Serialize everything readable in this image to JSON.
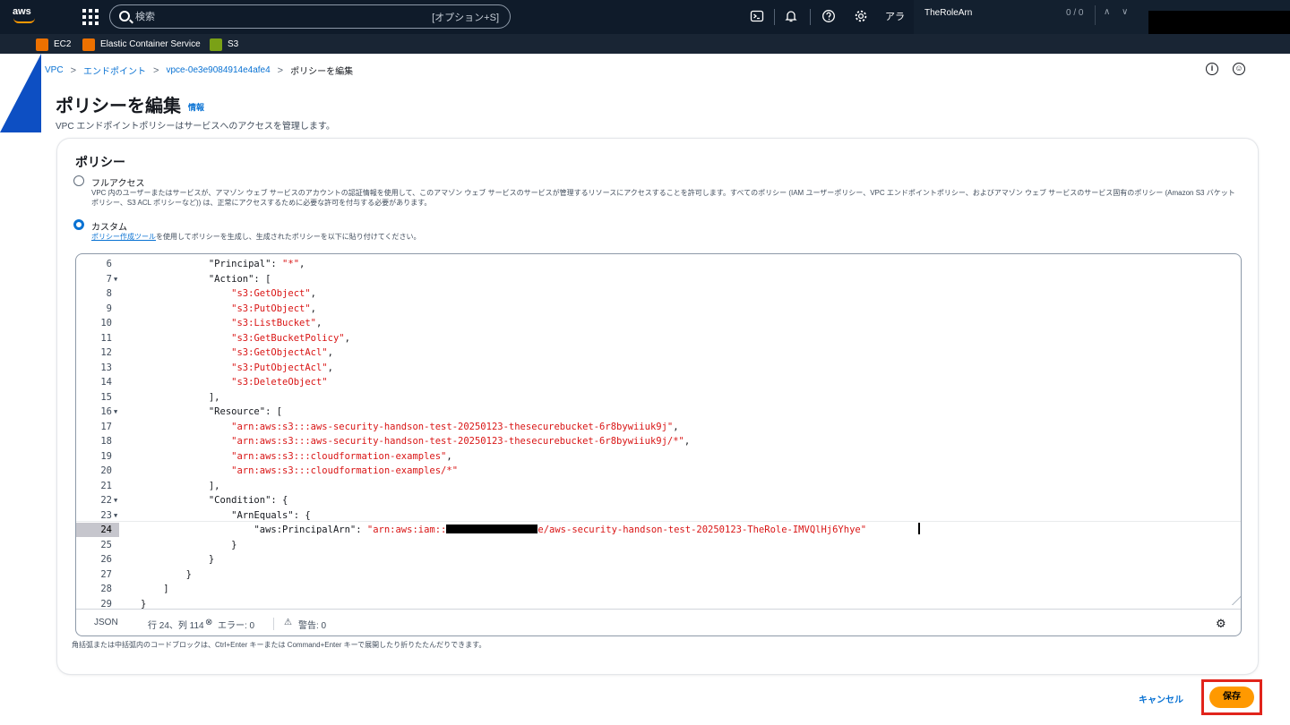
{
  "topnav": {
    "logo": "aws",
    "search_placeholder": "検索",
    "search_shortcut": "[オプション+S]",
    "account_truncated": "アラ",
    "icons": [
      "grid-icon",
      "cloudshell-icon",
      "bell-icon",
      "help-icon",
      "settings-icon"
    ],
    "find_bar": {
      "query": "TheRoleArn",
      "count": "0 / 0"
    }
  },
  "favorites": [
    {
      "label": "EC2",
      "icon": "ec2-icon",
      "color": "#ed7100"
    },
    {
      "label": "Elastic Container Service",
      "icon": "ecs-icon",
      "color": "#ed7100"
    },
    {
      "label": "S3",
      "icon": "s3-icon",
      "color": "#7aa116"
    }
  ],
  "breadcrumb": [
    {
      "label": "VPC",
      "link": true
    },
    {
      "label": "エンドポイント",
      "link": true
    },
    {
      "label": "vpce-0e3e9084914e4afe4",
      "link": true
    },
    {
      "label": "ポリシーを編集",
      "link": false
    }
  ],
  "header": {
    "title": "ポリシーを編集",
    "info": "情報",
    "description": "VPC エンドポイントポリシーはサービスへのアクセスを管理します。"
  },
  "policy": {
    "title": "ポリシー",
    "options": [
      {
        "label": "フルアクセス",
        "checked": false,
        "description": "VPC 内のユーザーまたはサービスが、アマゾン ウェブ サービスのアカウントの認証情報を使用して、このアマゾン ウェブ サービスのサービスが管理するリソースにアクセスすることを許可します。すべてのポリシー (IAM ユーザーポリシー、VPC エンドポイントポリシー、およびアマゾン ウェブ サービスのサービス固有のポリシー (Amazon S3 バケットポリシー、S3 ACL ポリシーなど)) は、正常にアクセスするために必要な許可を付与する必要があります。"
      },
      {
        "label": "カスタム",
        "checked": true,
        "description_link": "ポリシー作成ツール",
        "description": "を使用してポリシーを生成し、生成されたポリシーを以下に貼り付けてください。"
      }
    ]
  },
  "editor": {
    "lines": [
      {
        "n": "6",
        "fold": "",
        "indent": "            ",
        "parts": [
          {
            "t": "\"Principal\": ",
            "s": false
          },
          {
            "t": "\"*\"",
            "s": true
          },
          {
            "t": ",",
            "s": false
          }
        ]
      },
      {
        "n": "7",
        "fold": "▼",
        "indent": "            ",
        "parts": [
          {
            "t": "\"Action\": [",
            "s": false
          }
        ]
      },
      {
        "n": "8",
        "fold": "",
        "indent": "                ",
        "parts": [
          {
            "t": "\"s3:GetObject\"",
            "s": true
          },
          {
            "t": ",",
            "s": false
          }
        ]
      },
      {
        "n": "9",
        "fold": "",
        "indent": "                ",
        "parts": [
          {
            "t": "\"s3:PutObject\"",
            "s": true
          },
          {
            "t": ",",
            "s": false
          }
        ]
      },
      {
        "n": "10",
        "fold": "",
        "indent": "                ",
        "parts": [
          {
            "t": "\"s3:ListBucket\"",
            "s": true
          },
          {
            "t": ",",
            "s": false
          }
        ]
      },
      {
        "n": "11",
        "fold": "",
        "indent": "                ",
        "parts": [
          {
            "t": "\"s3:GetBucketPolicy\"",
            "s": true
          },
          {
            "t": ",",
            "s": false
          }
        ]
      },
      {
        "n": "12",
        "fold": "",
        "indent": "                ",
        "parts": [
          {
            "t": "\"s3:GetObjectAcl\"",
            "s": true
          },
          {
            "t": ",",
            "s": false
          }
        ]
      },
      {
        "n": "13",
        "fold": "",
        "indent": "                ",
        "parts": [
          {
            "t": "\"s3:PutObjectAcl\"",
            "s": true
          },
          {
            "t": ",",
            "s": false
          }
        ]
      },
      {
        "n": "14",
        "fold": "",
        "indent": "                ",
        "parts": [
          {
            "t": "\"s3:DeleteObject\"",
            "s": true
          }
        ]
      },
      {
        "n": "15",
        "fold": "",
        "indent": "            ",
        "parts": [
          {
            "t": "],",
            "s": false
          }
        ]
      },
      {
        "n": "16",
        "fold": "▼",
        "indent": "            ",
        "parts": [
          {
            "t": "\"Resource\": [",
            "s": false
          }
        ]
      },
      {
        "n": "17",
        "fold": "",
        "indent": "                ",
        "parts": [
          {
            "t": "\"arn:aws:s3:::aws-security-handson-test-20250123-thesecurebucket-6r8bywiiuk9j\"",
            "s": true
          },
          {
            "t": ",",
            "s": false
          }
        ]
      },
      {
        "n": "18",
        "fold": "",
        "indent": "                ",
        "parts": [
          {
            "t": "\"arn:aws:s3:::aws-security-handson-test-20250123-thesecurebucket-6r8bywiiuk9j/*\"",
            "s": true
          },
          {
            "t": ",",
            "s": false
          }
        ]
      },
      {
        "n": "19",
        "fold": "",
        "indent": "                ",
        "parts": [
          {
            "t": "\"arn:aws:s3:::cloudformation-examples\"",
            "s": true
          },
          {
            "t": ",",
            "s": false
          }
        ]
      },
      {
        "n": "20",
        "fold": "",
        "indent": "                ",
        "parts": [
          {
            "t": "\"arn:aws:s3:::cloudformation-examples/*\"",
            "s": true
          }
        ]
      },
      {
        "n": "21",
        "fold": "",
        "indent": "            ",
        "parts": [
          {
            "t": "],",
            "s": false
          }
        ]
      },
      {
        "n": "22",
        "fold": "▼",
        "indent": "            ",
        "parts": [
          {
            "t": "\"Condition\": {",
            "s": false
          }
        ]
      },
      {
        "n": "23",
        "fold": "▼",
        "indent": "                ",
        "parts": [
          {
            "t": "\"ArnEquals\": {",
            "s": false
          }
        ]
      },
      {
        "n": "24",
        "fold": "",
        "indent": "                    ",
        "active": true,
        "parts": [
          {
            "t": "\"aws:PrincipalArn\": ",
            "s": false
          },
          {
            "t": "\"arn:aws:iam::",
            "s": true
          },
          {
            "redact": true
          },
          {
            "t": "e/aws-security-handson-test-20250123-TheRole-IMVQlHj6Yhye\"",
            "s": true
          }
        ]
      },
      {
        "n": "25",
        "fold": "",
        "indent": "                ",
        "parts": [
          {
            "t": "}",
            "s": false
          }
        ]
      },
      {
        "n": "26",
        "fold": "",
        "indent": "            ",
        "parts": [
          {
            "t": "}",
            "s": false
          }
        ]
      },
      {
        "n": "27",
        "fold": "",
        "indent": "        ",
        "parts": [
          {
            "t": "}",
            "s": false
          }
        ]
      },
      {
        "n": "28",
        "fold": "",
        "indent": "    ",
        "parts": [
          {
            "t": "]",
            "s": false
          }
        ]
      },
      {
        "n": "29",
        "fold": "",
        "indent": "",
        "parts": [
          {
            "t": "}",
            "s": false
          }
        ]
      }
    ],
    "status": {
      "language": "JSON",
      "position": "行 24、列 114",
      "errors": "エラー: 0",
      "warnings": "警告: 0"
    },
    "hint": "角括弧または中括弧内のコードブロックは、Ctrl+Enter キーまたは Command+Enter キーで展開したり折りたたんだりできます。"
  },
  "footer": {
    "cancel": "キャンセル",
    "save": "保存"
  }
}
